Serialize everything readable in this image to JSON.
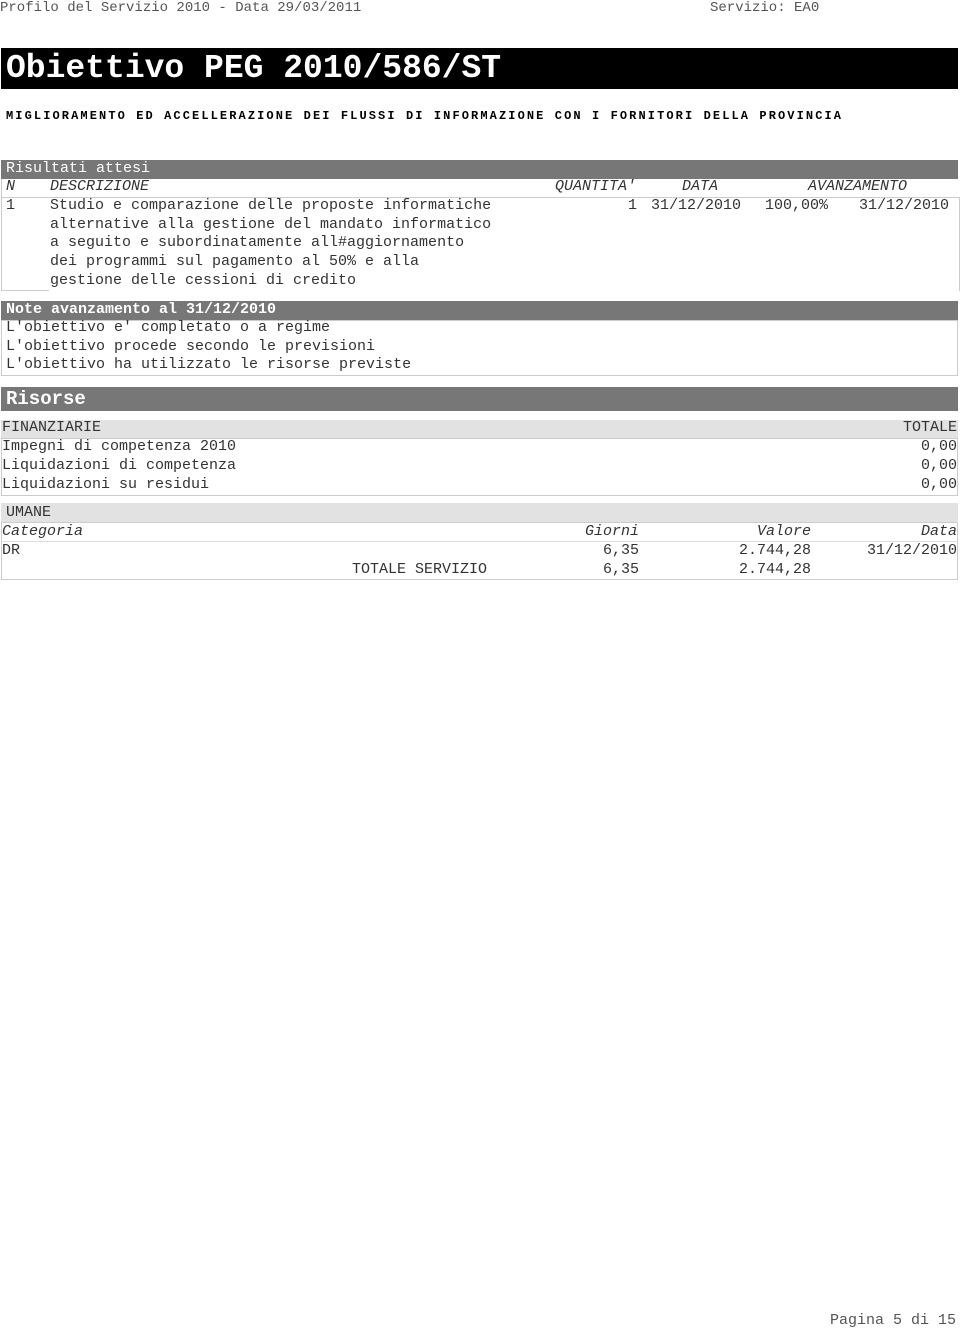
{
  "header": {
    "left": "Profilo del Servizio 2010 - Data 29/03/2011",
    "right": "Servizio: EA0"
  },
  "title": "Obiettivo PEG 2010/586/ST",
  "subtitle": "MIGLIORAMENTO ED ACCELLERAZIONE DEI FLUSSI DI INFORMAZIONE CON I FORNITORI DELLA PROVINCIA",
  "risultati": {
    "title": "Risultati attesi",
    "columns": [
      "N",
      "DESCRIZIONE",
      "QUANTITA'",
      "DATA",
      "AVANZAMENTO"
    ],
    "rows": [
      {
        "n": "1",
        "descrizione": [
          "Studio e comparazione delle proposte informatiche",
          "alternative alla gestione del mandato informatico",
          "a seguito e subordinatamente all#aggiornamento",
          "dei programmi sul pagamento al 50% e alla",
          "gestione delle cessioni di credito"
        ],
        "quantita": "1",
        "data": "31/12/2010",
        "avanzamento": "100,00%",
        "data_avanzamento": "31/12/2010"
      }
    ]
  },
  "note": {
    "title": "Note avanzamento al 31/12/2010",
    "lines": [
      "L'obiettivo e' completato o a regime",
      "L'obiettivo procede secondo le previsioni",
      "L'obiettivo ha utilizzato le risorse previste"
    ]
  },
  "risorse": {
    "title": "Risorse",
    "finanziarie": {
      "label": "FINANZIARIE",
      "total_label": "TOTALE",
      "rows": [
        {
          "label": "Impegni di competenza 2010",
          "value": "0,00"
        },
        {
          "label": "Liquidazioni di competenza",
          "value": "0,00"
        },
        {
          "label": "Liquidazioni su residui",
          "value": "0,00"
        }
      ]
    },
    "umane": {
      "label": "UMANE",
      "columns": [
        "Categoria",
        "Giorni",
        "Valore",
        "Data"
      ],
      "rows": [
        {
          "categoria": "DR",
          "giorni": "6,35",
          "valore": "2.744,28",
          "data": "31/12/2010"
        }
      ],
      "totale": {
        "label": "TOTALE SERVIZIO",
        "giorni": "6,35",
        "valore": "2.744,28"
      }
    }
  },
  "footer": "Pagina 5 di 15"
}
